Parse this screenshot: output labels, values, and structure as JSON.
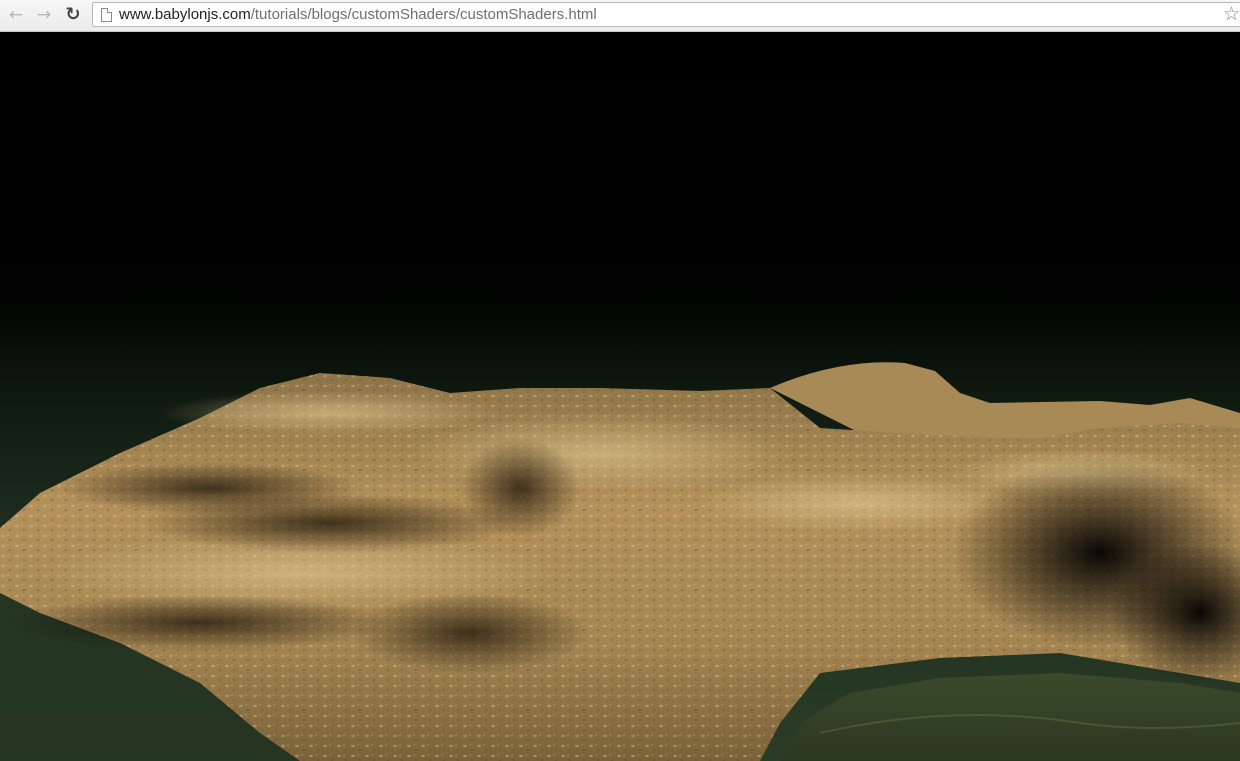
{
  "browser": {
    "back_icon": "back-arrow-icon",
    "forward_icon": "forward-arrow-icon",
    "reload_icon": "reload-icon",
    "url_domain": "www.babylonjs.com",
    "url_path": "/tutorials/blogs/customShaders/customShaders.html",
    "bookmark_icon": "star-icon"
  },
  "scene": {
    "description_role": "webgl-canvas",
    "sky_color": "#000000",
    "ground_color": "#1f3020",
    "terrain_color": "#b4915a",
    "water_color": "#3a4a2c"
  }
}
